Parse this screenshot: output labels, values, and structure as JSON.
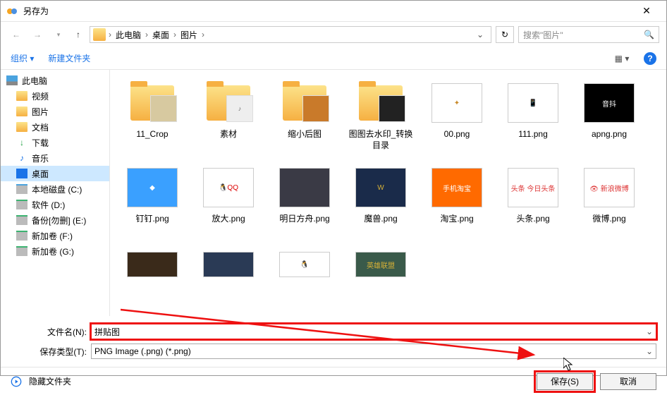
{
  "window": {
    "title": "另存为"
  },
  "nav": {
    "breadcrumb": [
      "此电脑",
      "桌面",
      "图片"
    ],
    "search_placeholder": "搜索\"图片\""
  },
  "toolbar": {
    "organize": "组织",
    "newfolder": "新建文件夹"
  },
  "sidebar": {
    "items": [
      {
        "label": "此电脑",
        "icon": "pc",
        "root": true
      },
      {
        "label": "视频",
        "icon": "folder"
      },
      {
        "label": "图片",
        "icon": "folder"
      },
      {
        "label": "文档",
        "icon": "folder"
      },
      {
        "label": "下载",
        "icon": "dl"
      },
      {
        "label": "音乐",
        "icon": "music"
      },
      {
        "label": "桌面",
        "icon": "desk",
        "selected": true
      },
      {
        "label": "本地磁盘 (C:)",
        "icon": "drive"
      },
      {
        "label": "软件 (D:)",
        "icon": "drive-g"
      },
      {
        "label": "备份[勿删] (E:)",
        "icon": "drive-g"
      },
      {
        "label": "新加卷 (F:)",
        "icon": "drive-g"
      },
      {
        "label": "新加卷 (G:)",
        "icon": "drive-g"
      }
    ]
  },
  "files": [
    {
      "name": "11_Crop",
      "kind": "folder",
      "ov_bg": "#d7c9a0",
      "ov_txt": ""
    },
    {
      "name": "素材",
      "kind": "folder",
      "ov_bg": "#eee",
      "ov_txt": "♪"
    },
    {
      "name": "缩小后图",
      "kind": "folder",
      "ov_bg": "#c97a2a",
      "ov_txt": ""
    },
    {
      "name": "图图去水印_转换目录",
      "kind": "folder",
      "ov_bg": "#222",
      "ov_txt": ""
    },
    {
      "name": "00.png",
      "kind": "img",
      "bg": "#fff",
      "txt": "✦",
      "fg": "#c88a2a"
    },
    {
      "name": "111.png",
      "kind": "img",
      "bg": "#fff",
      "txt": "📱",
      "fg": "#333"
    },
    {
      "name": "apng.png",
      "kind": "img",
      "bg": "#000",
      "txt": "音抖",
      "fg": "#fff"
    },
    {
      "name": "钉钉.png",
      "kind": "img",
      "bg": "#3aa0ff",
      "txt": "◆",
      "fg": "#fff"
    },
    {
      "name": "放大.png",
      "kind": "img",
      "bg": "#fff",
      "txt": "🐧QQ",
      "fg": "#d00"
    },
    {
      "name": "明日方舟.png",
      "kind": "img",
      "bg": "#3a3a45",
      "txt": "",
      "fg": "#fff"
    },
    {
      "name": "魔兽.png",
      "kind": "img",
      "bg": "#1a2b4a",
      "txt": "W",
      "fg": "#d4af37"
    },
    {
      "name": "淘宝.png",
      "kind": "img",
      "bg": "#ff6a00",
      "txt": "手机淘宝",
      "fg": "#fff"
    },
    {
      "name": "头条.png",
      "kind": "img",
      "bg": "#fff",
      "txt": "头条 今日头条",
      "fg": "#d33"
    },
    {
      "name": "微博.png",
      "kind": "img",
      "bg": "#fff",
      "txt": "👁 新浪微博",
      "fg": "#d33"
    },
    {
      "name": "",
      "kind": "img",
      "bg": "#3a2a1a",
      "txt": "",
      "fg": "#fff",
      "partial": true
    },
    {
      "name": "",
      "kind": "img",
      "bg": "#2a3a55",
      "txt": "",
      "fg": "#fff",
      "partial": true
    },
    {
      "name": "",
      "kind": "img",
      "bg": "#fff",
      "txt": "🐧",
      "fg": "#000",
      "partial": true
    },
    {
      "name": "",
      "kind": "img",
      "bg": "#3a5a4a",
      "txt": "英雄联盟",
      "fg": "#d4af37",
      "partial": true
    }
  ],
  "form": {
    "filename_label": "文件名(N):",
    "filename_value": "拼贴图",
    "type_label": "保存类型(T):",
    "type_value": "PNG Image (.png) (*.png)"
  },
  "footer": {
    "hide": "隐藏文件夹",
    "save": "保存(S)",
    "cancel": "取消"
  }
}
